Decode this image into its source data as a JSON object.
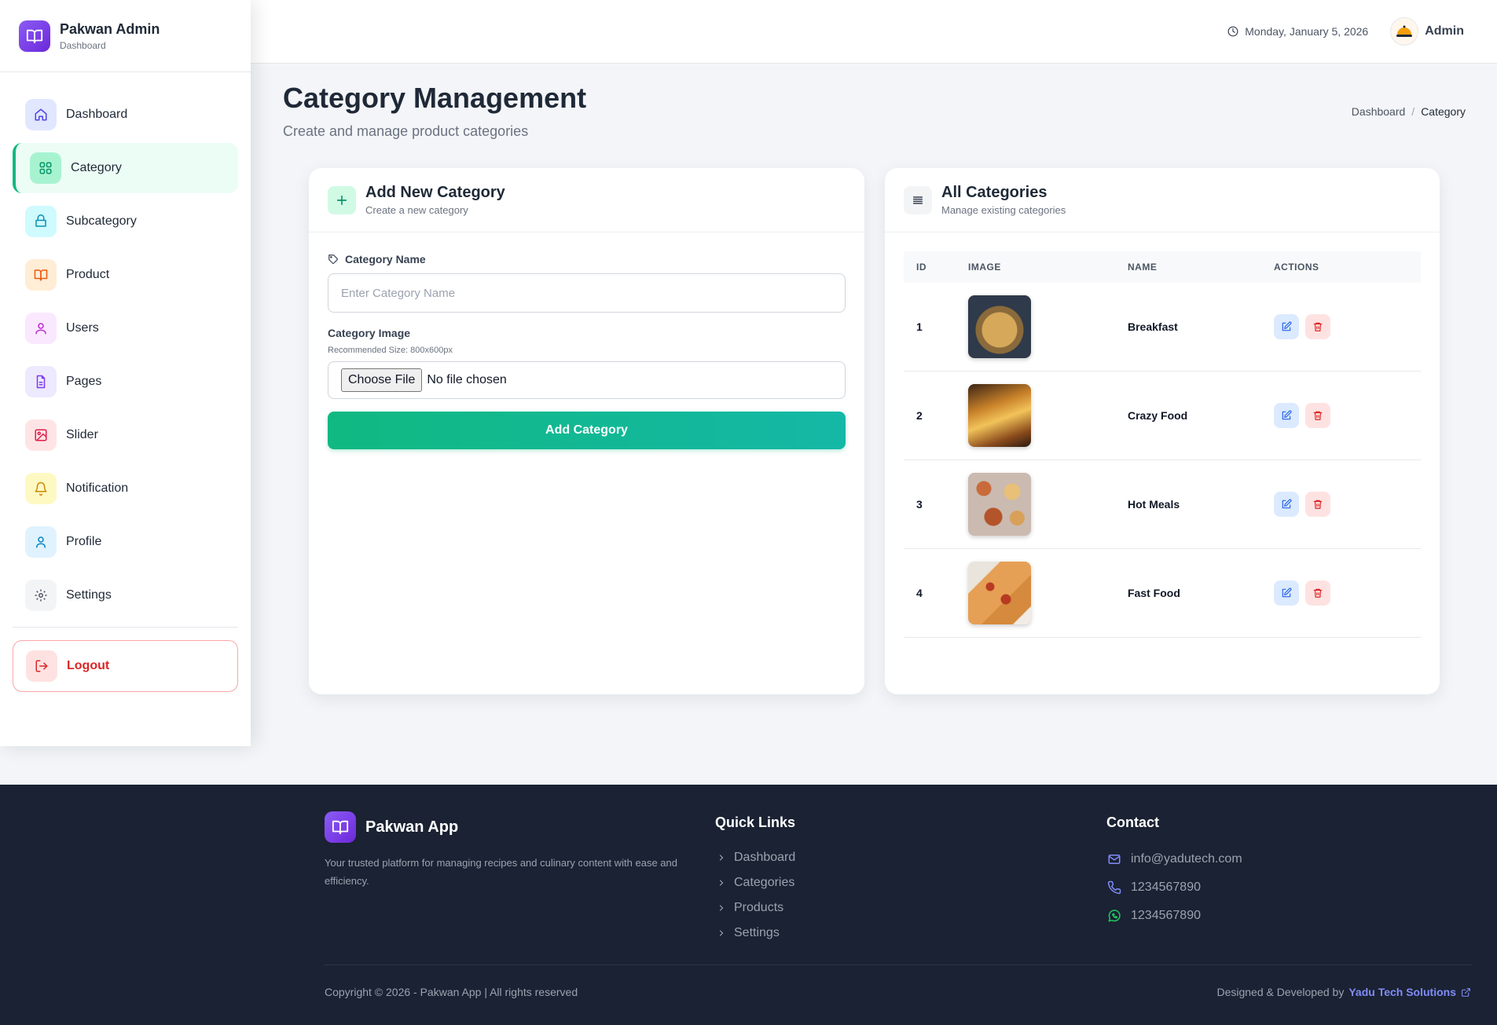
{
  "brand": {
    "title": "Pakwan Admin",
    "subtitle": "Dashboard"
  },
  "sidebar": {
    "items": [
      {
        "label": "Dashboard",
        "icon": "home-icon",
        "color": "#4f46e5",
        "bg": "#e0e7ff",
        "active": false
      },
      {
        "label": "Category",
        "icon": "grid-icon",
        "color": "#10b981",
        "bg": "#a7f3d0",
        "active": true
      },
      {
        "label": "Subcategory",
        "icon": "layers-icon",
        "color": "#0891b2",
        "bg": "#cffafe",
        "active": false
      },
      {
        "label": "Product",
        "icon": "book-icon",
        "color": "#ea580c",
        "bg": "#ffedd5",
        "active": false
      },
      {
        "label": "Users",
        "icon": "users-icon",
        "color": "#c026d3",
        "bg": "#fae8ff",
        "active": false
      },
      {
        "label": "Pages",
        "icon": "file-icon",
        "color": "#7c3aed",
        "bg": "#ede9fe",
        "active": false
      },
      {
        "label": "Slider",
        "icon": "image-icon",
        "color": "#e11d48",
        "bg": "#ffe4e6",
        "active": false
      },
      {
        "label": "Notification",
        "icon": "bell-icon",
        "color": "#ca8a04",
        "bg": "#fef9c3",
        "active": false
      },
      {
        "label": "Profile",
        "icon": "user-icon",
        "color": "#0284c7",
        "bg": "#e0f2fe",
        "active": false
      },
      {
        "label": "Settings",
        "icon": "gear-icon",
        "color": "#4b5563",
        "bg": "#f3f4f6",
        "active": false
      }
    ],
    "logout_label": "Logout"
  },
  "header": {
    "date": "Monday, January 5, 2026",
    "user_name": "Admin"
  },
  "page": {
    "title": "Category Management",
    "subtitle": "Create and manage product categories",
    "breadcrumb": {
      "home": "Dashboard",
      "separator": "/",
      "current": "Category"
    }
  },
  "add_form": {
    "title": "Add New Category",
    "subtitle": "Create a new category",
    "name_label": "Category Name",
    "name_placeholder": "Enter Category Name",
    "image_label": "Category Image",
    "image_hint": "Recommended Size: 800x600px",
    "file_button": "Choose File",
    "file_status": "No file chosen",
    "submit_label": "Add Category"
  },
  "list": {
    "title": "All Categories",
    "subtitle": "Manage existing categories",
    "columns": {
      "id": "ID",
      "image": "IMAGE",
      "name": "NAME",
      "actions": "ACTIONS"
    },
    "rows": [
      {
        "id": "1",
        "name": "Breakfast",
        "image": "breakfast-thumbnail"
      },
      {
        "id": "2",
        "name": "Crazy Food",
        "image": "crazy-food-thumbnail"
      },
      {
        "id": "3",
        "name": "Hot Meals",
        "image": "hot-meals-thumbnail"
      },
      {
        "id": "4",
        "name": "Fast Food",
        "image": "fast-food-thumbnail"
      }
    ]
  },
  "footer": {
    "brand": "Pakwan App",
    "description": "Your trusted platform for managing recipes and culinary content with ease and efficiency.",
    "quick_links_title": "Quick Links",
    "quick_links": [
      "Dashboard",
      "Categories",
      "Products",
      "Settings"
    ],
    "contact_title": "Contact",
    "email": "info@yadutech.com",
    "phone": "1234567890",
    "whatsapp": "1234567890",
    "copyright": "Copyright © 2026 - Pakwan App | All rights reserved",
    "credit_prefix": "Designed & Developed by",
    "credit_name": "Yadu Tech Solutions"
  },
  "colors": {
    "accent": "#10b981",
    "brand": "#7c3aed",
    "footer_bg": "#1a2233",
    "danger": "#dc2626",
    "link": "#818cf8"
  }
}
